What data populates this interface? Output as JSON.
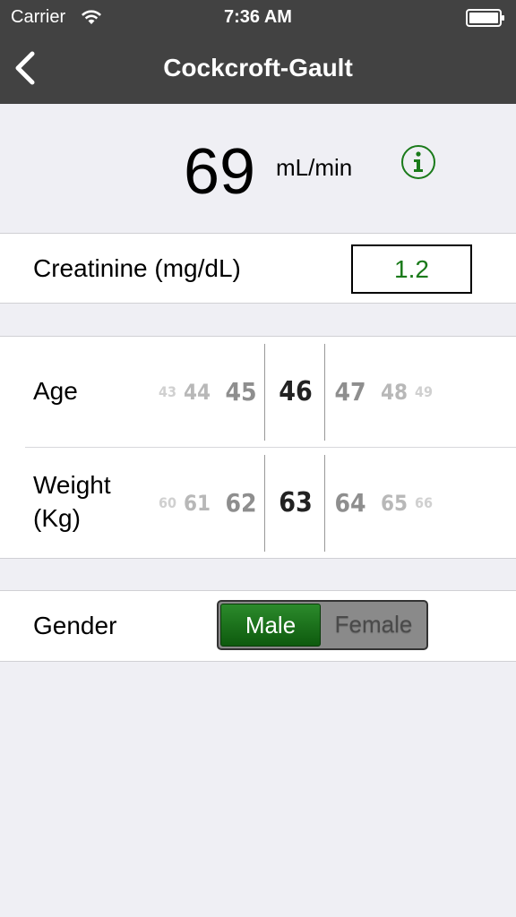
{
  "status_bar": {
    "carrier": "Carrier",
    "time": "7:36 AM"
  },
  "nav": {
    "title": "Cockcroft-Gault",
    "back_icon": "chevron-left-icon"
  },
  "result": {
    "value": "69",
    "unit": "mL/min",
    "info_icon": "info-circle-icon",
    "info_color": "#1a7a1a"
  },
  "creatinine": {
    "label": "Creatinine (mg/dL)",
    "value": "1.2"
  },
  "age": {
    "label": "Age",
    "options": [
      "43",
      "44",
      "45",
      "46",
      "47",
      "48",
      "49"
    ],
    "selected": "46"
  },
  "weight": {
    "label_line1": "Weight",
    "label_line2": "(Kg)",
    "options": [
      "60",
      "61",
      "62",
      "63",
      "64",
      "65",
      "66"
    ],
    "selected": "63"
  },
  "gender": {
    "label": "Gender",
    "options": [
      "Male",
      "Female"
    ],
    "selected": "Male",
    "accent": "#1a7a1a"
  }
}
